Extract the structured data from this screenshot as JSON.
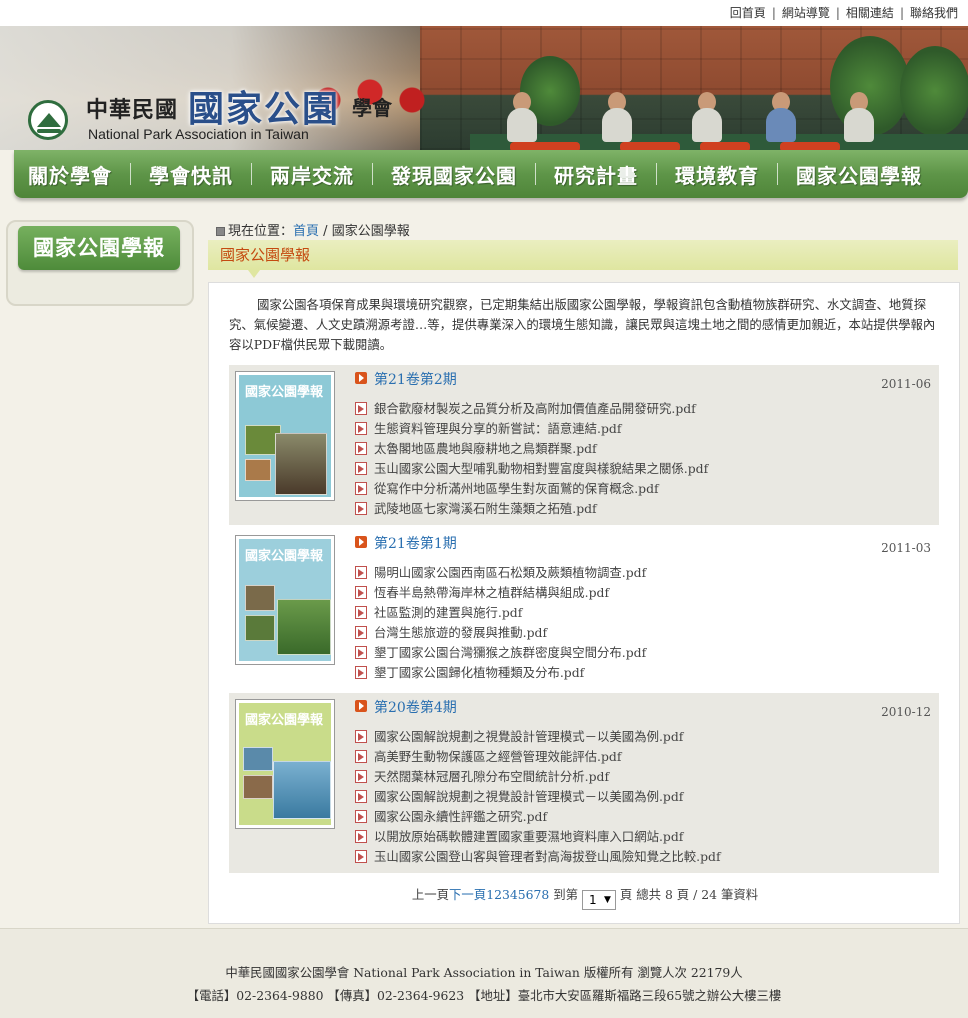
{
  "top_links": [
    "回首頁",
    "網站導覽",
    "相關連結",
    "聯絡我們"
  ],
  "logo": {
    "zh_prefix": "中華民國",
    "zh_main": "國家公園",
    "zh_suffix": "學會",
    "en": "National Park Association in Taiwan"
  },
  "nav": [
    "關於學會",
    "學會快訊",
    "兩岸交流",
    "發現國家公園",
    "研究計畫",
    "環境教育",
    "國家公園學報"
  ],
  "sidebar": {
    "title": "國家公園學報"
  },
  "breadcrumb": {
    "prefix": "現在位置：",
    "home": "首頁",
    "sep": " / ",
    "current": "國家公園學報"
  },
  "section_title": "國家公園學報",
  "intro": "國家公園各項保育成果與環境研究觀察，已定期集結出版國家公園學報，學報資訊包含動植物族群研究、水文調查、地質探究、氣候變遷、人文史蹟溯源考證…等，提供專業深入的環境生態知識，讓民眾與這塊土地之間的感情更加親近，本站提供學報內容以PDF檔供民眾下載閱讀。",
  "issues": [
    {
      "title": "第21卷第2期",
      "date": "2011-06",
      "cover_title": "國家公園學報",
      "cover_color": "#8dc9d6",
      "files": [
        "銀合歡廢材製炭之品質分析及高附加價值產品開發研究.pdf",
        "生態資料管理與分享的新嘗試：語意連結.pdf",
        "太魯閣地區農地與廢耕地之鳥類群聚.pdf",
        "玉山國家公園大型哺乳動物相對豐富度與樣貌結果之關係.pdf",
        "從寫作中分析滿州地區學生對灰面鷲的保育概念.pdf",
        "武陵地區七家灣溪石附生藻類之拓殖.pdf"
      ]
    },
    {
      "title": "第21卷第1期",
      "date": "2011-03",
      "cover_title": "國家公園學報",
      "cover_color": "#9ccfdc",
      "files": [
        "陽明山國家公園西南區石松類及蕨類植物調查.pdf",
        "恆春半島熱帶海岸林之植群結構與組成.pdf",
        "社區監測的建置與施行.pdf",
        "台灣生態旅遊的發展與推動.pdf",
        "墾丁國家公園台灣獼猴之族群密度與空間分布.pdf",
        "墾丁國家公園歸化植物種類及分布.pdf"
      ]
    },
    {
      "title": "第20卷第4期",
      "date": "2010-12",
      "cover_title": "國家公園學報",
      "cover_color": "#c9dc8a",
      "files": [
        "國家公園解說規劃之視覺設計管理模式－以美國為例.pdf",
        "高美野生動物保護區之經營管理效能評估.pdf",
        "天然闊葉林冠層孔隙分布空間統計分析.pdf",
        "國家公園解說規劃之視覺設計管理模式－以美國為例.pdf",
        "國家公園永續性評鑑之研究.pdf",
        "以開放原始碼軟體建置國家重要濕地資料庫入口網站.pdf",
        "玉山國家公園登山客與管理者對高海拔登山風險知覺之比較.pdf"
      ]
    }
  ],
  "pager": {
    "prev": "上一頁",
    "next": "下一頁",
    "pages": "12345678",
    "goto": "到第",
    "selected": "1",
    "summary": "頁 總共 8 頁 / 24 筆資料"
  },
  "footer": {
    "line1": "中華民國國家公園學會 National Park Association in Taiwan 版權所有 瀏覽人次 22179人",
    "line2": "【電話】02-2364-9880 【傳真】02-2364-9623 【地址】臺北市大安區羅斯福路三段65號之辦公大樓三樓"
  },
  "colors": {
    "nav_green": "#5e9548",
    "link_blue": "#2a6fb0",
    "title_orange": "#c44a10",
    "title_bar": "#dfe6a0"
  }
}
